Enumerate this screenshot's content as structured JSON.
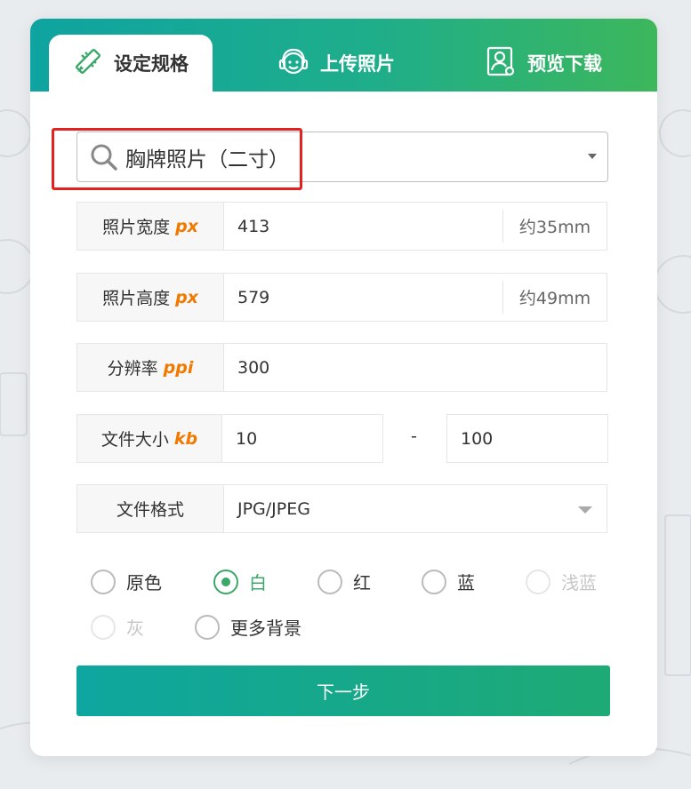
{
  "tabs": [
    {
      "label": "设定规格",
      "icon": "ruler-pencil-icon",
      "active": true
    },
    {
      "label": "上传照片",
      "icon": "face-icon",
      "active": false
    },
    {
      "label": "预览下载",
      "icon": "portrait-download-icon",
      "active": false
    }
  ],
  "spec_select": {
    "value": "胸牌照片（二寸）",
    "icon": "search-icon"
  },
  "fields": {
    "width": {
      "label": "照片宽度",
      "unit": "px",
      "value": "413",
      "suffix": "约35mm"
    },
    "height": {
      "label": "照片高度",
      "unit": "px",
      "value": "579",
      "suffix": "约49mm"
    },
    "resolution": {
      "label": "分辨率",
      "unit": "ppi",
      "value": "300"
    },
    "file_size": {
      "label": "文件大小",
      "unit": "kb",
      "min": "10",
      "separator": "-",
      "max": "100"
    },
    "format": {
      "label": "文件格式",
      "value": "JPG/JPEG"
    }
  },
  "backgrounds": [
    {
      "label": "原色",
      "checked": false,
      "disabled": false
    },
    {
      "label": "白",
      "checked": true,
      "disabled": false
    },
    {
      "label": "红",
      "checked": false,
      "disabled": false
    },
    {
      "label": "蓝",
      "checked": false,
      "disabled": false
    },
    {
      "label": "浅蓝",
      "checked": false,
      "disabled": true
    },
    {
      "label": "灰",
      "checked": false,
      "disabled": true
    },
    {
      "label": "更多背景",
      "checked": false,
      "disabled": false
    }
  ],
  "next_button": "下一步",
  "colors": {
    "accent": "#3aa86b",
    "header_start": "#0fa3a1",
    "header_end": "#3db75c",
    "unit": "#f07a00",
    "highlight": "#e3211f"
  }
}
